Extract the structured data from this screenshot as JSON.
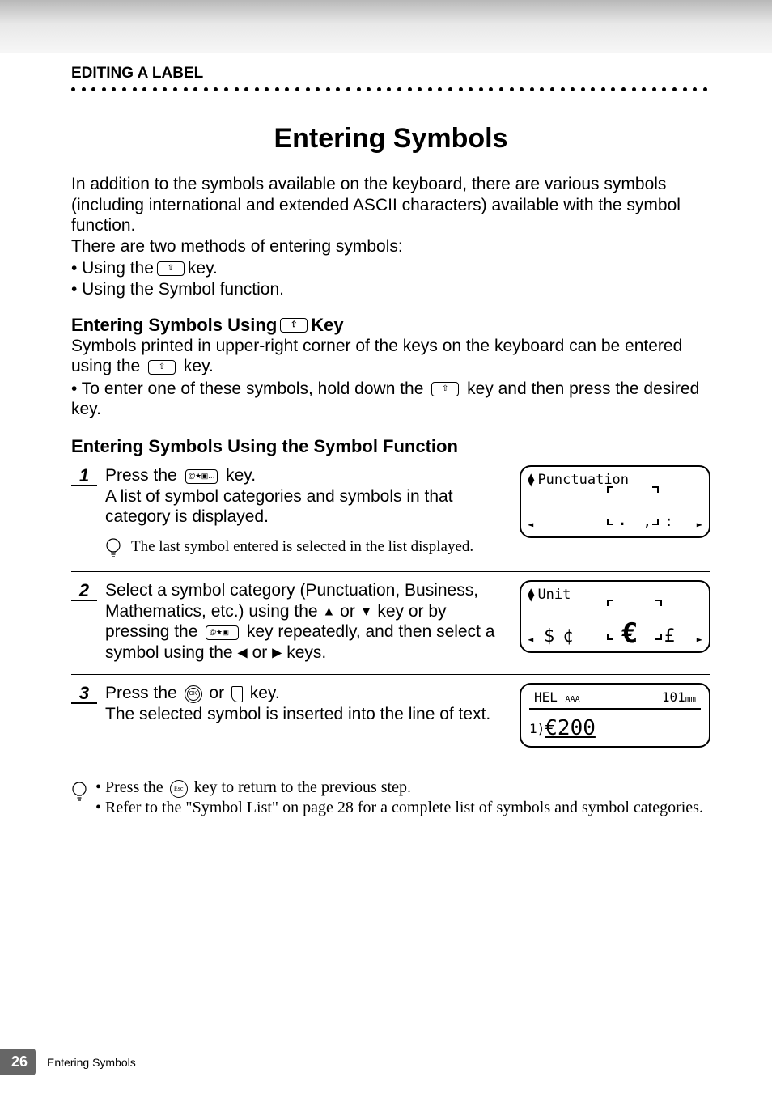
{
  "section_label": "EDITING A LABEL",
  "main_title": "Entering Symbols",
  "intro": {
    "p1": "In addition to the symbols available on the keyboard, there are various symbols (including international and extended ASCII characters) available with the symbol function.",
    "p2": "There are two methods of entering symbols:",
    "b1a": "• Using the ",
    "b1b": " key.",
    "b2": "• Using the Symbol function."
  },
  "sub1": {
    "title_a": "Entering Symbols Using ",
    "title_b": " Key",
    "line1a": "Symbols printed in upper-right corner of the keys on the keyboard can be entered using the ",
    "line1b": " key.",
    "bullet_a": "• To enter one of these symbols, hold down the ",
    "bullet_b": " key and then press the desired key."
  },
  "sub2_title": "Entering Symbols Using the Symbol Function",
  "steps": {
    "s1": {
      "num": "1",
      "a": "Press the ",
      "b": " key.",
      "c": "A list of symbol categories and symbols in that category is displayed.",
      "hint": "The last symbol entered is selected in the list displayed.",
      "screen_title": "Punctuation",
      "seq": [
        ".",
        ",",
        ":"
      ]
    },
    "s2": {
      "num": "2",
      "a": "Select a symbol category (Punctuation, Business, Mathematics, etc.) using the ",
      "b": " or ",
      "c": " key or by pressing the ",
      "d": " key repeatedly, and then select a symbol using the ",
      "e": " or ",
      "f": " keys.",
      "screen_title": "Unit",
      "seq": [
        "$",
        "¢",
        "€",
        "£"
      ]
    },
    "s3": {
      "num": "3",
      "a": "Press the ",
      "b": " or ",
      "c": " key.",
      "d": "The selected symbol is inserted into the line of text.",
      "top_left": "HEL",
      "top_right_num": "101",
      "top_right_unit": "mm",
      "bigline": "€200",
      "lineprefix": "1)"
    }
  },
  "tips": {
    "t1a": "• Press the ",
    "t1b": " key to return to the previous step.",
    "t2": "• Refer to the \"Symbol List\" on page 28 for a complete list of symbols and symbol categories."
  },
  "footer": {
    "page": "26",
    "text": "Entering Symbols"
  },
  "icons": {
    "shift": "⇧",
    "sym": "@★▣…",
    "ok": "OK",
    "esc": "Esc",
    "up": "▲",
    "down": "▼",
    "left": "◀",
    "right": "▶",
    "ltri": "◄",
    "rtri": "►",
    "aAA": "AAA"
  }
}
